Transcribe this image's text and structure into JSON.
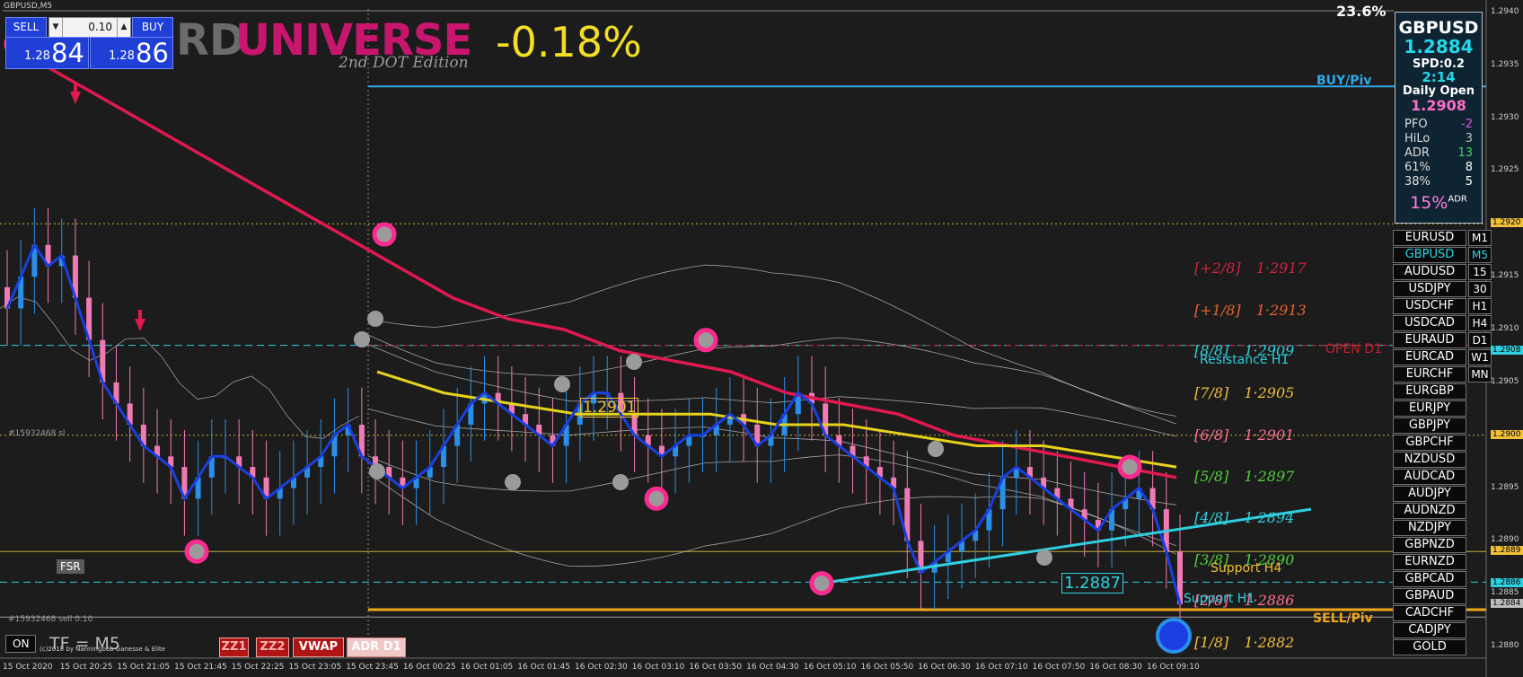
{
  "window": {
    "title": "GBPUSD,M5",
    "fib_top_label": "23.6%"
  },
  "trade_panel": {
    "sell_label": "SELL",
    "buy_label": "BUY",
    "lot": "0.10",
    "sell_price_small": "1.28",
    "sell_price_big": "84",
    "buy_price_small": "1.28",
    "buy_price_big": "86"
  },
  "header": {
    "brand_part": "RD",
    "brand": "UNIVERSE",
    "edition": "2nd DOT Edition",
    "change": "-0.18%"
  },
  "info_panel": {
    "symbol": "GBPUSD",
    "price": "1.2884",
    "spread": "SPD:0.2",
    "timer": "2:14",
    "daily_open_label": "Daily Open",
    "daily_open": "1.2908",
    "stats": [
      {
        "label": "PFO",
        "value": "-2",
        "color": "#d060e0"
      },
      {
        "label": "HiLo",
        "value": "3",
        "color": "#bdbdbd"
      },
      {
        "label": "ADR",
        "value": "13",
        "color": "#3fd35a"
      },
      {
        "label": "61%",
        "value": "8",
        "color": "#ffffff"
      },
      {
        "label": "38%",
        "value": "5",
        "color": "#ffffff"
      }
    ],
    "adr_pct": "15%",
    "adr_sup": "ADR"
  },
  "symbols": [
    "EURUSD",
    "GBPUSD",
    "AUDUSD",
    "USDJPY",
    "USDCHF",
    "USDCAD",
    "EURAUD",
    "EURCAD",
    "EURCHF",
    "EURGBP",
    "EURJPY",
    "GBPJPY",
    "GBPCHF",
    "NZDUSD",
    "AUDCAD",
    "AUDJPY",
    "AUDNZD",
    "NZDJPY",
    "GBPNZD",
    "EURNZD",
    "GBPCAD",
    "GBPAUD",
    "CADCHF",
    "CADJPY",
    "GOLD"
  ],
  "active_symbol": "GBPUSD",
  "timeframes": [
    "M1",
    "M5",
    "15",
    "30",
    "H1",
    "H4",
    "D1",
    "W1",
    "MN"
  ],
  "active_timeframe": "M5",
  "fibo_levels": [
    {
      "label": "[+2/8]",
      "value": "1·2917",
      "color": "#d0243a"
    },
    {
      "label": "[+1/8]",
      "value": "1·2913",
      "color": "#e8622b"
    },
    {
      "label": "[8/8]",
      "value": "1·2909",
      "color": "#2fd0e0"
    },
    {
      "label": "[7/8]",
      "value": "1·2905",
      "color": "#f0c03a"
    },
    {
      "label": "[6/8]",
      "value": "1·2901",
      "color": "#ff6f8f"
    },
    {
      "label": "[5/8]",
      "value": "1·2897",
      "color": "#4fcf3a"
    },
    {
      "label": "[4/8]",
      "value": "1·2894",
      "color": "#2fd0e0"
    },
    {
      "label": "[3/8]",
      "value": "1·2890",
      "color": "#4fcf3a"
    },
    {
      "label": "[2/8]",
      "value": "1·2886",
      "color": "#ff6f8f"
    },
    {
      "label": "[1/8]",
      "value": "1·2882",
      "color": "#f0c03a"
    }
  ],
  "labels": {
    "buy_pivot": "BUY/Piv",
    "sell_pivot": "SELL/Piv",
    "resistance": "Resistance H1",
    "support_h4": "Support H4",
    "support_h1": "Support H1",
    "open_d1": "OPEN D1",
    "price_box_1": "1.2901",
    "price_box_2": "1.2887",
    "order_sl": "#15932468 sl",
    "order_sell": "#15932468 sell 0.10",
    "fsr": "FSR",
    "on": "ON",
    "tf": "TF = M5",
    "copyright": "(c)2018 by Nanningbob Ganesse & Elite",
    "zz1": "ZZ1",
    "zz2": "ZZ2",
    "vwap": "VWAP",
    "adr_d1": "ADR D1"
  },
  "price_axis": [
    {
      "text": "1.2940",
      "price": 1.294
    },
    {
      "text": "1.2935",
      "price": 1.2935
    },
    {
      "text": "1.2930",
      "price": 1.293
    },
    {
      "text": "1.2925",
      "price": 1.2925
    },
    {
      "text": "1.2920",
      "price": 1.292,
      "tag": "#f0c03a"
    },
    {
      "text": "1.2915",
      "price": 1.2915
    },
    {
      "text": "1.2910",
      "price": 1.291
    },
    {
      "text": "1.2908",
      "price": 1.2908,
      "tag": "#2fd0e0"
    },
    {
      "text": "1.2905",
      "price": 1.2905
    },
    {
      "text": "1.2900",
      "price": 1.29,
      "tag": "#f0c03a"
    },
    {
      "text": "1.2895",
      "price": 1.2895
    },
    {
      "text": "1.2890",
      "price": 1.289
    },
    {
      "text": "1.2889",
      "price": 1.2889,
      "tag": "#f0c03a"
    },
    {
      "text": "1.2886",
      "price": 1.2886,
      "tag": "#2fd0e0"
    },
    {
      "text": "1.2885",
      "price": 1.2885
    },
    {
      "text": "1.2884",
      "price": 1.2884,
      "tag": "#bdbdbd"
    },
    {
      "text": "1.2880",
      "price": 1.288
    }
  ],
  "time_axis": [
    "15 Oct 2020",
    "15 Oct 20:25",
    "15 Oct 21:05",
    "15 Oct 21:45",
    "15 Oct 22:25",
    "15 Oct 23:05",
    "15 Oct 23:45",
    "16 Oct 00:25",
    "16 Oct 01:05",
    "16 Oct 01:45",
    "16 Oct 02:30",
    "16 Oct 03:10",
    "16 Oct 03:50",
    "16 Oct 04:30",
    "16 Oct 05:10",
    "16 Oct 05:50",
    "16 Oct 06:30",
    "16 Oct 07:10",
    "16 Oct 07:50",
    "16 Oct 08:30",
    "16 Oct 09:10"
  ],
  "colors": {
    "bg": "#1c1c1c",
    "red_ma": "#e0194f",
    "yellow_ma": "#e6d21b",
    "blue_ma": "#1a3fe0",
    "cyan": "#2fd0e0",
    "bull": "#2a8fe8",
    "bear": "#f07ab4"
  },
  "chart_data": {
    "type": "candlestick",
    "ylim": [
      1.2879,
      1.2941
    ],
    "series_close": [
      1.2912,
      1.2915,
      1.2918,
      1.2916,
      1.2917,
      1.2913,
      1.2909,
      1.2905,
      1.2903,
      1.2901,
      1.2899,
      1.2898,
      1.2897,
      1.2894,
      1.2896,
      1.2898,
      1.2898,
      1.2897,
      1.2896,
      1.2894,
      1.2895,
      1.2896,
      1.2897,
      1.2898,
      1.29,
      1.2901,
      1.2898,
      1.2897,
      1.2896,
      1.2895,
      1.2896,
      1.2897,
      1.2899,
      1.2901,
      1.2903,
      1.2904,
      1.2903,
      1.2902,
      1.2901,
      1.29,
      1.2899,
      1.2901,
      1.2903,
      1.2904,
      1.2904,
      1.2902,
      1.29,
      1.2899,
      1.2898,
      1.2899,
      1.29,
      1.29,
      1.2901,
      1.2902,
      1.2901,
      1.2899,
      1.29,
      1.2902,
      1.2904,
      1.2903,
      1.29,
      1.2899,
      1.2898,
      1.2897,
      1.2896,
      1.2895,
      1.289,
      1.2887,
      1.2888,
      1.2889,
      1.289,
      1.2891,
      1.2893,
      1.2896,
      1.2897,
      1.2896,
      1.2895,
      1.2894,
      1.2893,
      1.2892,
      1.2891,
      1.2893,
      1.2894,
      1.2895,
      1.2893,
      1.2889,
      1.2884
    ],
    "red_ma": [
      1.2937,
      1.2934,
      1.2931,
      1.2928,
      1.2925,
      1.2922,
      1.2919,
      1.2916,
      1.2913,
      1.2911,
      1.291,
      1.2908,
      1.2907,
      1.2906,
      1.2904,
      1.2903,
      1.2902,
      1.29,
      1.2899,
      1.2898,
      1.2897,
      1.2896
    ],
    "yellow_ma": [
      1.2906,
      1.2904,
      1.2903,
      1.2902,
      1.2902,
      1.2902,
      1.2901,
      1.2901,
      1.29,
      1.2899,
      1.2899,
      1.2898,
      1.2897
    ],
    "trendline_start": 1.2886,
    "trendline_end": 1.2893
  }
}
